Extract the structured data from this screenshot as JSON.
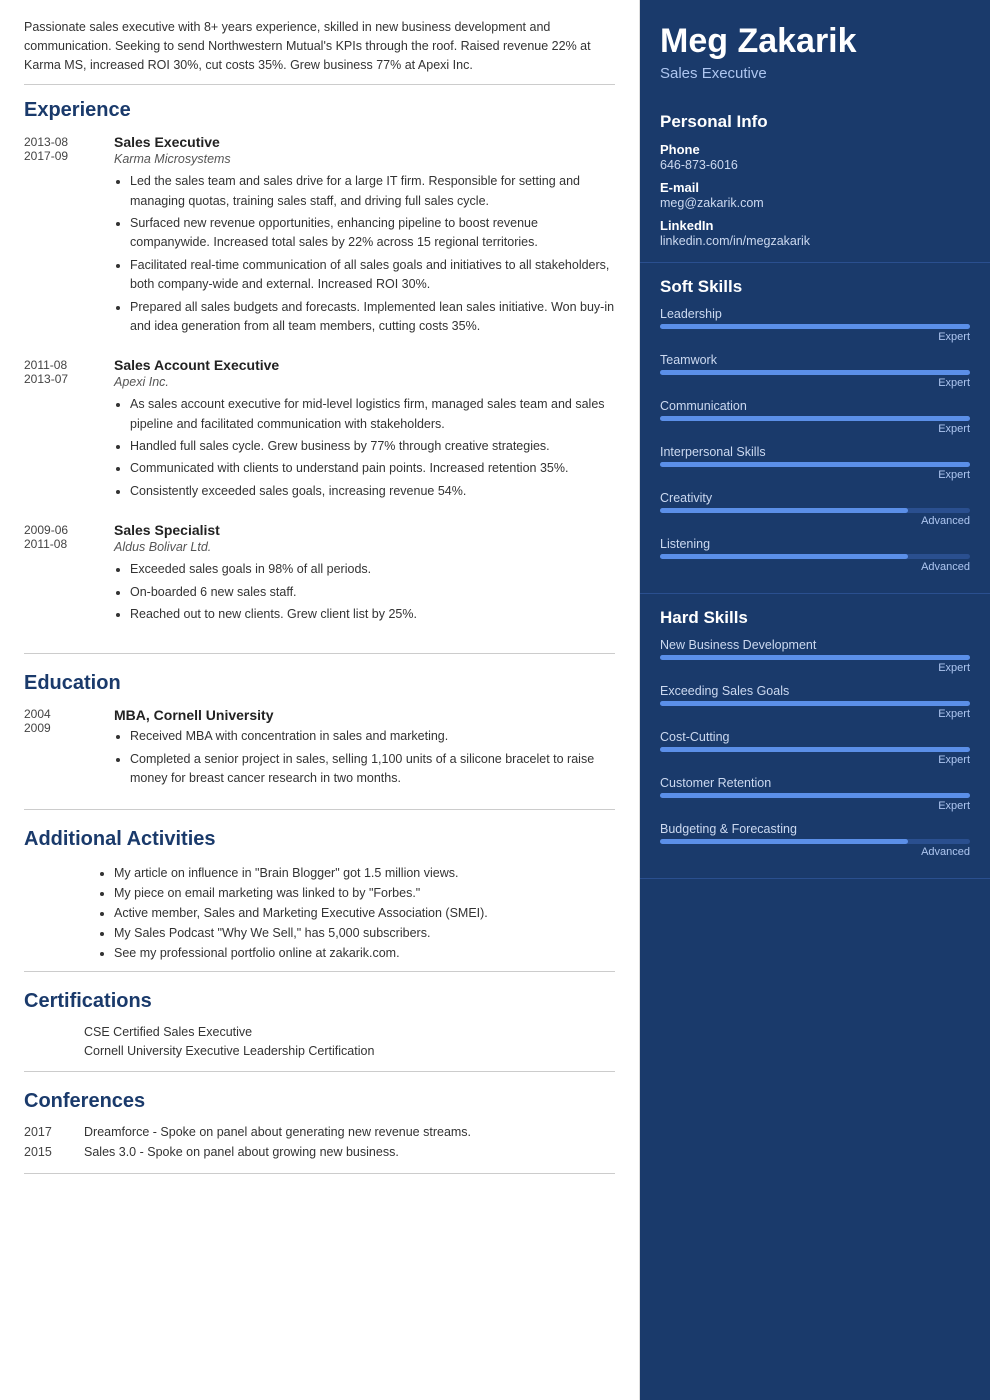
{
  "summary": "Passionate sales executive with 8+ years experience, skilled in new business development and communication. Seeking to send Northwestern Mutual's KPIs through the roof. Raised revenue 22% at Karma MS, increased ROI 30%, cut costs 35%. Grew business 77% at Apexi Inc.",
  "name": "Meg Zakarik",
  "job_title": "Sales Executive",
  "personal_info": {
    "title": "Personal Info",
    "phone_label": "Phone",
    "phone": "646-873-6016",
    "email_label": "E-mail",
    "email": "meg@zakarik.com",
    "linkedin_label": "LinkedIn",
    "linkedin": "linkedin.com/in/megzakarik"
  },
  "sections": {
    "experience_title": "Experience",
    "education_title": "Education",
    "additional_title": "Additional Activities",
    "certifications_title": "Certifications",
    "conferences_title": "Conferences"
  },
  "experience": [
    {
      "dates": "2013-08 - 2017-09",
      "title": "Sales Executive",
      "company": "Karma Microsystems",
      "bullets": [
        "Led the sales team and sales drive for a large IT firm. Responsible for setting and managing quotas, training sales staff, and driving full sales cycle.",
        "Surfaced new revenue opportunities, enhancing pipeline to boost revenue companywide. Increased total sales by 22% across 15 regional territories.",
        "Facilitated real-time communication of all sales goals and initiatives to all stakeholders, both company-wide and external. Increased ROI 30%.",
        "Prepared all sales budgets and forecasts. Implemented lean sales initiative. Won buy-in and idea generation from all team members, cutting costs 35%."
      ]
    },
    {
      "dates": "2011-08 - 2013-07",
      "title": "Sales Account Executive",
      "company": "Apexi Inc.",
      "bullets": [
        "As sales account executive for mid-level logistics firm, managed sales team and sales pipeline and facilitated communication with stakeholders.",
        "Handled full sales cycle. Grew business by 77% through creative strategies.",
        "Communicated with clients to understand pain points. Increased retention 35%.",
        "Consistently exceeded sales goals, increasing revenue 54%."
      ]
    },
    {
      "dates": "2009-06 - 2011-08",
      "title": "Sales Specialist",
      "company": "Aldus Bolivar Ltd.",
      "bullets": [
        "Exceeded sales goals in 98% of all periods.",
        "On-boarded 6 new sales staff.",
        "Reached out to new clients. Grew client list by 25%."
      ]
    }
  ],
  "education": [
    {
      "dates": "2004 - 2009",
      "title": "MBA, Cornell University",
      "bullets": [
        "Received MBA with concentration in sales and marketing.",
        "Completed a senior project in sales, selling 1,100 units of a silicone bracelet to raise money for breast cancer research in two months."
      ]
    }
  ],
  "activities": [
    "My article on influence in \"Brain Blogger\" got 1.5 million views.",
    "My piece on email marketing was linked to by \"Forbes.\"",
    "Active member, Sales and Marketing Executive Association (SMEI).",
    "My Sales Podcast \"Why We Sell,\" has 5,000 subscribers.",
    "See my professional portfolio online at zakarik.com."
  ],
  "certifications": [
    "CSE Certified Sales Executive",
    "Cornell University Executive Leadership Certification"
  ],
  "conferences": [
    {
      "year": "2017",
      "desc": "Dreamforce - Spoke on panel about generating new revenue streams."
    },
    {
      "year": "2015",
      "desc": "Sales 3.0 - Spoke on panel about growing new business."
    }
  ],
  "soft_skills_title": "Soft Skills",
  "hard_skills_title": "Hard Skills",
  "soft_skills": [
    {
      "name": "Leadership",
      "level": "Expert",
      "pct": 100
    },
    {
      "name": "Teamwork",
      "level": "Expert",
      "pct": 100
    },
    {
      "name": "Communication",
      "level": "Expert",
      "pct": 100
    },
    {
      "name": "Interpersonal Skills",
      "level": "Expert",
      "pct": 100
    },
    {
      "name": "Creativity",
      "level": "Advanced",
      "pct": 80
    },
    {
      "name": "Listening",
      "level": "Advanced",
      "pct": 80
    }
  ],
  "hard_skills": [
    {
      "name": "New Business Development",
      "level": "Expert",
      "pct": 100
    },
    {
      "name": "Exceeding Sales Goals",
      "level": "Expert",
      "pct": 100
    },
    {
      "name": "Cost-Cutting",
      "level": "Expert",
      "pct": 100
    },
    {
      "name": "Customer Retention",
      "level": "Expert",
      "pct": 100
    },
    {
      "name": "Budgeting & Forecasting",
      "level": "Advanced",
      "pct": 80
    }
  ]
}
